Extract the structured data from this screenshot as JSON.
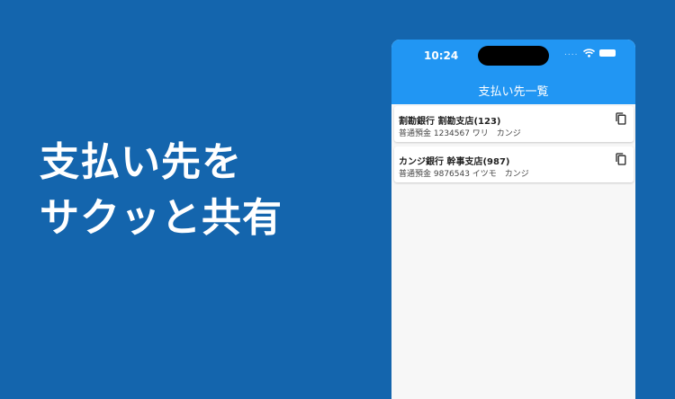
{
  "headline": {
    "line1": "支払い先を",
    "line2": "サクッと共有"
  },
  "status_bar": {
    "time": "10:24",
    "signal": "....",
    "icons": [
      "wifi-icon",
      "battery-icon"
    ]
  },
  "app_bar": {
    "title": "支払い先一覧",
    "color": "#2196f3"
  },
  "payees": [
    {
      "title": "割勘銀行 割勘支店(123)",
      "detail": "普通預金 1234567 ワリ　カンジ",
      "icon": "copy-icon"
    },
    {
      "title": "カンジ銀行 幹事支店(987)",
      "detail": "普通預金 9876543 イツモ　カンジ",
      "icon": "copy-icon"
    }
  ],
  "colors": {
    "background": "#1465ad",
    "accent": "#2196f3",
    "list_background": "#f7f7f7"
  }
}
